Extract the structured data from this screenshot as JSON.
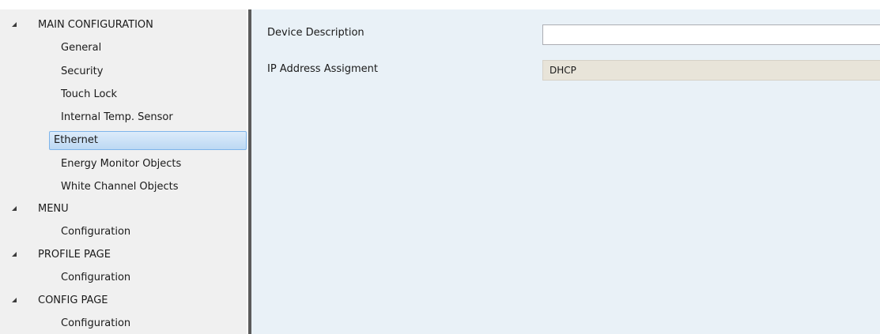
{
  "tree": {
    "groups": [
      {
        "label": "MAIN CONFIGURATION",
        "children": [
          "General",
          "Security",
          "Touch Lock",
          "Internal Temp. Sensor",
          "Ethernet",
          "Energy Monitor Objects",
          "White Channel Objects"
        ]
      },
      {
        "label": "MENU",
        "children": [
          "Configuration"
        ]
      },
      {
        "label": "PROFILE PAGE",
        "children": [
          "Configuration"
        ]
      },
      {
        "label": "CONFIG PAGE",
        "children": [
          "Configuration"
        ]
      }
    ],
    "selected": "Ethernet"
  },
  "params": {
    "device_description": {
      "label": "Device Description",
      "value": ""
    },
    "ip_address": {
      "label": "IP Address Assigment",
      "value": "DHCP"
    }
  }
}
